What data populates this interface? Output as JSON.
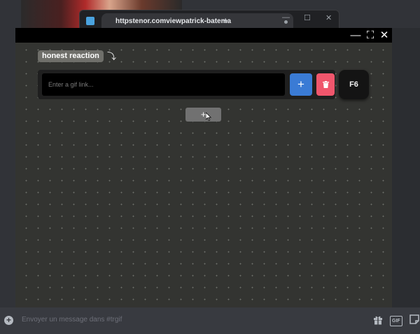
{
  "browser": {
    "tab_title": "httpstenor.comviewpatrick-batema",
    "new_tab": "+",
    "minimize": "—",
    "maximize": "☐",
    "close": "✕"
  },
  "overlay": {
    "window_controls": {
      "minimize": "—",
      "fullscreen": "⛶",
      "close": "✕"
    },
    "reaction_label": "honest reaction",
    "reaction_arrow": "⤵",
    "gif_input_placeholder": "Enter a gif link...",
    "add_button": "+",
    "keybind": "F6",
    "add_row_button": "+"
  },
  "message_bar": {
    "placeholder": "Envoyer un message dans #trgif",
    "gif_label": "GIF"
  },
  "colors": {
    "add_button": "#3a7bd5",
    "delete_button": "#f0566c",
    "overlay_bg": "#333431"
  }
}
